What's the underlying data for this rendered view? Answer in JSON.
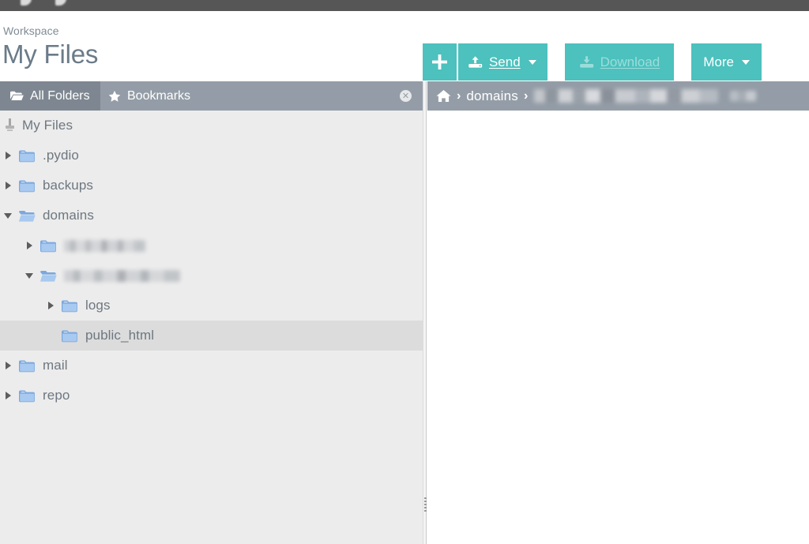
{
  "window": {
    "top_strip_color": "#565656"
  },
  "header": {
    "workspace_label": "Workspace",
    "title": "My Files"
  },
  "toolbar": {
    "accent_color": "#4cc1bd",
    "new_label": "+",
    "new_icon": "plus-icon",
    "send_label": "Send",
    "send_icon": "upload-icon",
    "send_caret": "caret-down-icon",
    "download_label": "Download",
    "download_icon": "download-icon",
    "download_disabled": true,
    "more_label": "More",
    "more_caret": "caret-down-icon"
  },
  "tabs": {
    "all_folders": {
      "label": "All Folders",
      "icon": "folder-open-icon",
      "active": true
    },
    "bookmarks": {
      "label": "Bookmarks",
      "icon": "star-icon",
      "active": false
    },
    "close_label": "✕"
  },
  "tree": {
    "root": {
      "label": "My Files",
      "icon": "drive-icon"
    },
    "items": [
      {
        "label": ".pydio",
        "indent": 0,
        "state": "collapsed",
        "icon": "folder-icon",
        "redacted": false
      },
      {
        "label": "backups",
        "indent": 0,
        "state": "collapsed",
        "icon": "folder-icon",
        "redacted": false
      },
      {
        "label": "domains",
        "indent": 0,
        "state": "expanded",
        "icon": "folder-open-icon",
        "redacted": false
      },
      {
        "label": "",
        "indent": 1,
        "state": "collapsed",
        "icon": "folder-icon",
        "redacted": true,
        "redacted_width": 103
      },
      {
        "label": "",
        "indent": 1,
        "state": "expanded",
        "icon": "folder-open-icon",
        "redacted": true,
        "redacted_width": 147
      },
      {
        "label": "logs",
        "indent": 2,
        "state": "collapsed",
        "icon": "folder-icon",
        "redacted": false
      },
      {
        "label": "public_html",
        "indent": 2,
        "state": "leaf",
        "icon": "folder-icon",
        "redacted": false,
        "selected": true
      },
      {
        "label": "mail",
        "indent": 0,
        "state": "collapsed",
        "icon": "folder-icon",
        "redacted": false
      },
      {
        "label": "repo",
        "indent": 0,
        "state": "collapsed",
        "icon": "folder-icon",
        "redacted": false
      }
    ]
  },
  "breadcrumb": {
    "home_icon": "home-icon",
    "separator": "›",
    "segments": [
      {
        "label": "domains",
        "redacted": false
      },
      {
        "label": "",
        "redacted": true,
        "redacted_width": 233
      },
      {
        "label": "",
        "redacted": true,
        "redacted_width": 33
      }
    ]
  },
  "file_list": {
    "items": []
  },
  "splitter": {
    "grip_icon": "grip-dots-icon"
  }
}
